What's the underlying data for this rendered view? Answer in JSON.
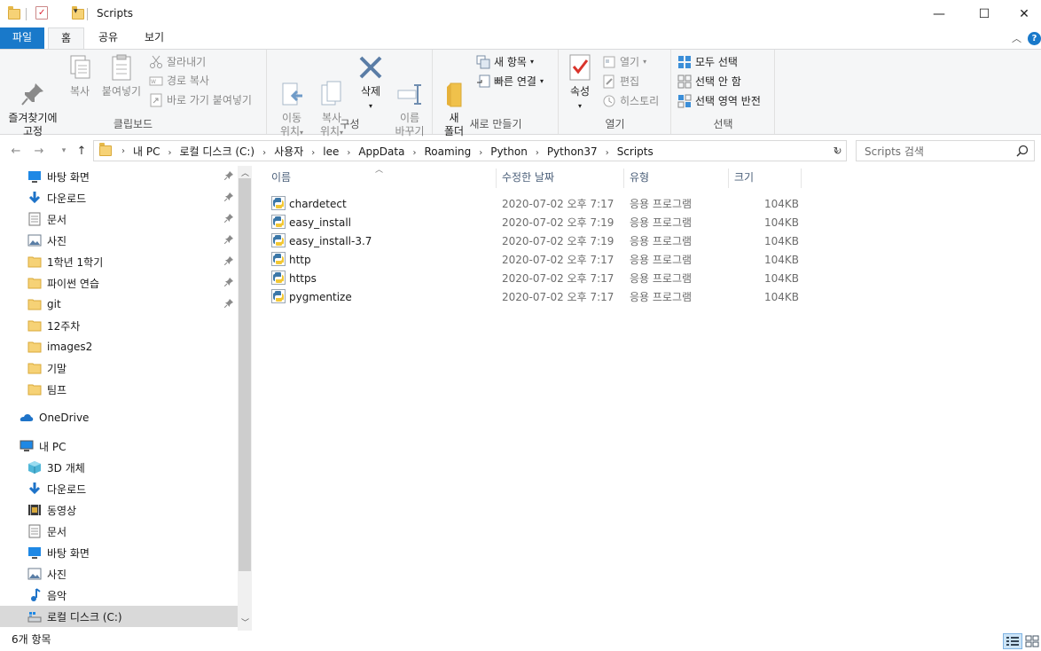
{
  "window": {
    "title": "Scripts",
    "minimize": "—",
    "maximize": "☐",
    "close": "✕"
  },
  "ribbon_tabs": [
    "파일",
    "홈",
    "공유",
    "보기"
  ],
  "ribbon": {
    "clipboard": {
      "label": "클립보드",
      "pin_quick": "즐겨찾기에\n고정",
      "copy": "복사",
      "paste": "붙여넣기",
      "cut": "잘라내기",
      "copy_path": "경로 복사",
      "paste_shortcut": "바로 가기 붙여넣기"
    },
    "organize": {
      "label": "구성",
      "move_to": "이동\n위치",
      "copy_to": "복사\n위치",
      "delete": "삭제",
      "rename": "이름\n바꾸기"
    },
    "new": {
      "label": "새로 만들기",
      "new_folder": "새\n폴더",
      "new_item": "새 항목",
      "easy_access": "빠른 연결"
    },
    "open": {
      "label": "열기",
      "properties": "속성",
      "open": "열기",
      "edit": "편집",
      "history": "히스토리"
    },
    "select": {
      "label": "선택",
      "select_all": "모두 선택",
      "select_none": "선택 안 함",
      "invert": "선택 영역 반전"
    }
  },
  "address": {
    "crumbs": [
      "내 PC",
      "로컬 디스크 (C:)",
      "사용자",
      "lee",
      "AppData",
      "Roaming",
      "Python",
      "Python37",
      "Scripts"
    ]
  },
  "search": {
    "placeholder": "Scripts 검색"
  },
  "sidebar": {
    "quick_access": [
      {
        "label": "바탕 화면",
        "icon": "desktop-icon",
        "pinned": true
      },
      {
        "label": "다운로드",
        "icon": "download-icon",
        "pinned": true
      },
      {
        "label": "문서",
        "icon": "document-icon",
        "pinned": true
      },
      {
        "label": "사진",
        "icon": "pictures-icon",
        "pinned": true
      },
      {
        "label": "1학년 1학기",
        "icon": "folder-icon",
        "pinned": true
      },
      {
        "label": "파이썬 연습",
        "icon": "folder-icon",
        "pinned": true
      },
      {
        "label": "git",
        "icon": "folder-icon",
        "pinned": true
      },
      {
        "label": "12주차",
        "icon": "folder-icon",
        "pinned": false
      },
      {
        "label": "images2",
        "icon": "folder-icon",
        "pinned": false
      },
      {
        "label": "기말",
        "icon": "folder-icon",
        "pinned": false
      },
      {
        "label": "팀프",
        "icon": "folder-icon",
        "pinned": false
      }
    ],
    "onedrive": "OneDrive",
    "this_pc": "내 PC",
    "this_pc_items": [
      {
        "label": "3D 개체",
        "icon": "3d-objects-icon"
      },
      {
        "label": "다운로드",
        "icon": "download-icon"
      },
      {
        "label": "동영상",
        "icon": "video-icon"
      },
      {
        "label": "문서",
        "icon": "document-icon"
      },
      {
        "label": "바탕 화면",
        "icon": "desktop-icon"
      },
      {
        "label": "사진",
        "icon": "pictures-icon"
      },
      {
        "label": "음악",
        "icon": "music-icon"
      },
      {
        "label": "로컬 디스크 (C:)",
        "icon": "drive-icon"
      }
    ]
  },
  "columns": {
    "name": "이름",
    "date": "수정한 날짜",
    "type": "유형",
    "size": "크기"
  },
  "files": [
    {
      "name": "chardetect",
      "date": "2020-07-02 오후 7:17",
      "type": "응용 프로그램",
      "size": "104KB"
    },
    {
      "name": "easy_install",
      "date": "2020-07-02 오후 7:19",
      "type": "응용 프로그램",
      "size": "104KB"
    },
    {
      "name": "easy_install-3.7",
      "date": "2020-07-02 오후 7:19",
      "type": "응용 프로그램",
      "size": "104KB"
    },
    {
      "name": "http",
      "date": "2020-07-02 오후 7:17",
      "type": "응용 프로그램",
      "size": "104KB"
    },
    {
      "name": "https",
      "date": "2020-07-02 오후 7:17",
      "type": "응용 프로그램",
      "size": "104KB"
    },
    {
      "name": "pygmentize",
      "date": "2020-07-02 오후 7:17",
      "type": "응용 프로그램",
      "size": "104KB"
    }
  ],
  "status": {
    "item_count": "6개 항목"
  },
  "colors": {
    "accent": "#1979ca",
    "folder": "#f6d276",
    "selected": "#d9d9d9"
  }
}
